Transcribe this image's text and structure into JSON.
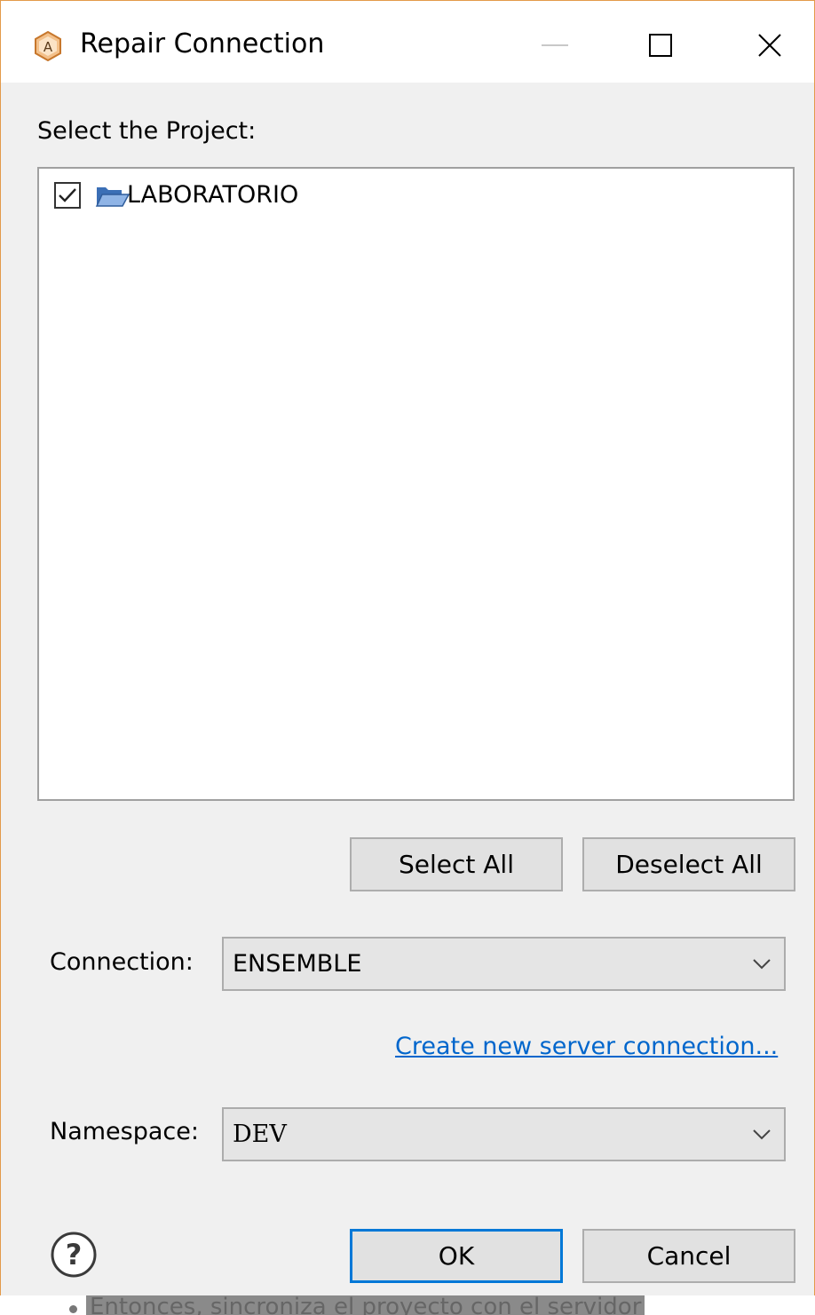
{
  "window": {
    "title": "Repair Connection"
  },
  "project_section": {
    "label": "Select the Project:",
    "projects": [
      {
        "name": "LABORATORIO",
        "checked": true
      }
    ]
  },
  "buttons": {
    "select_all": "Select All",
    "deselect_all": "Deselect All",
    "ok": "OK",
    "cancel": "Cancel"
  },
  "connection": {
    "label": "Connection:",
    "value": "ENSEMBLE"
  },
  "create_link": "Create new server connection...",
  "namespace": {
    "label": "Namespace:",
    "value": "DEV"
  },
  "caption": "Entonces, sincroniza el proyecto con el servidor",
  "icons": {
    "app": "atelier-app-icon",
    "minimize": "minimize-icon",
    "maximize": "maximize-icon",
    "close": "close-icon",
    "folder": "open-folder-icon",
    "help": "help-icon",
    "dropdown": "chevron-down-icon"
  },
  "colors": {
    "accent": "#0078d7",
    "link": "#0066cc",
    "window_border": "#e39a4a"
  }
}
